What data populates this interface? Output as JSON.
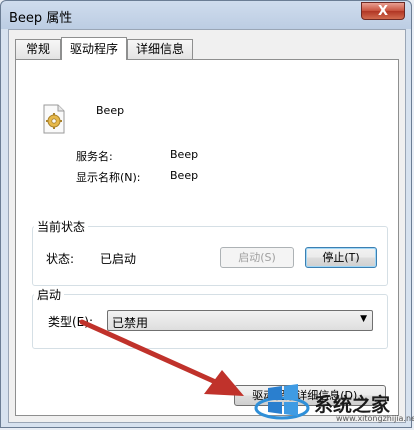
{
  "window": {
    "title": "Beep 属性",
    "close_glyph": "X"
  },
  "tabs": [
    {
      "label": "常规"
    },
    {
      "label": "驱动程序"
    },
    {
      "label": "详细信息"
    }
  ],
  "service": {
    "icon": "gear-file-icon",
    "name": "Beep",
    "rows": [
      {
        "label": "服务名:",
        "value": "Beep"
      },
      {
        "label": "显示名称(N):",
        "value": "Beep"
      }
    ]
  },
  "status_group": {
    "title": "当前状态",
    "status_label": "状态:",
    "status_value": "已启动",
    "start_button": "启动(S)",
    "stop_button": "停止(T)"
  },
  "startup_group": {
    "title": "启动",
    "type_label": "类型(E):",
    "type_value": "已禁用"
  },
  "driver_details_button": "驱动程序详细信息(D)...",
  "watermark": {
    "text": "系统之家",
    "sub": "www.xitongzhijia.net"
  },
  "colors": {
    "arrow": "#c0322b",
    "close_button": "#c7513d"
  }
}
